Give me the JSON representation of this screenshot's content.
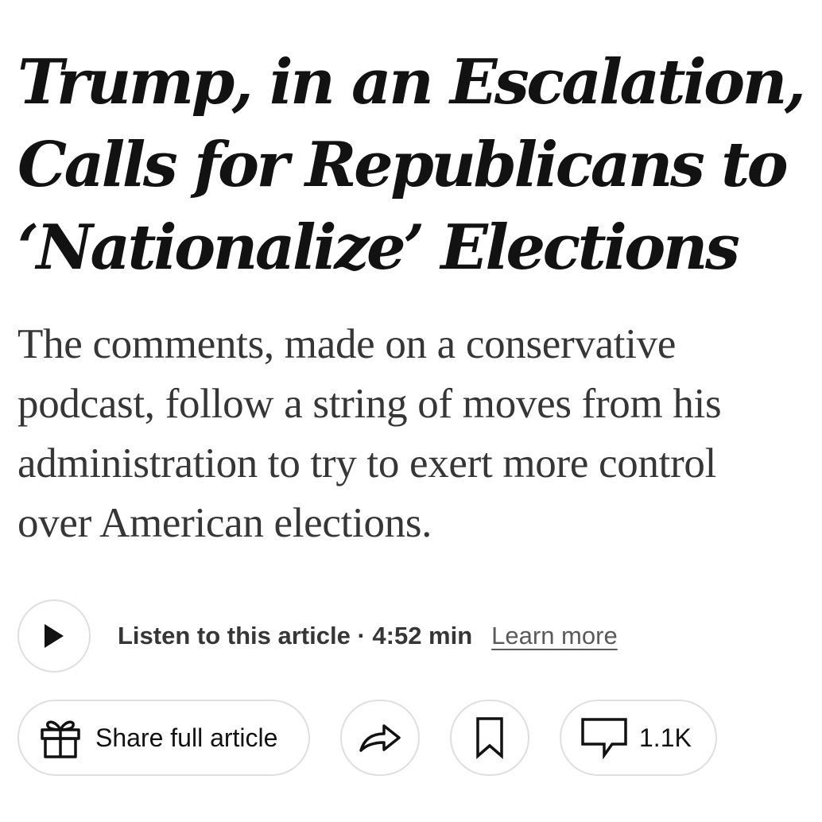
{
  "article": {
    "headline_lines": [
      "Trump, in an Escalation,",
      "Calls for Republicans to",
      "‘Nationalize’ Elections"
    ],
    "summary_lines": [
      "The comments, made on a conservative",
      "podcast, follow a string of moves from his",
      "administration to try to exert more control",
      "over American elections."
    ]
  },
  "audio": {
    "play_icon": "play-icon",
    "label": "Listen to this article · 4:52 min",
    "learn_more": "Learn more"
  },
  "actions": {
    "share_full_label": "Share full article",
    "share_full_icon": "gift-icon",
    "share_icon": "share-arrow-icon",
    "save_icon": "bookmark-icon",
    "comments_icon": "comment-icon",
    "comments_count": "1.1K"
  }
}
